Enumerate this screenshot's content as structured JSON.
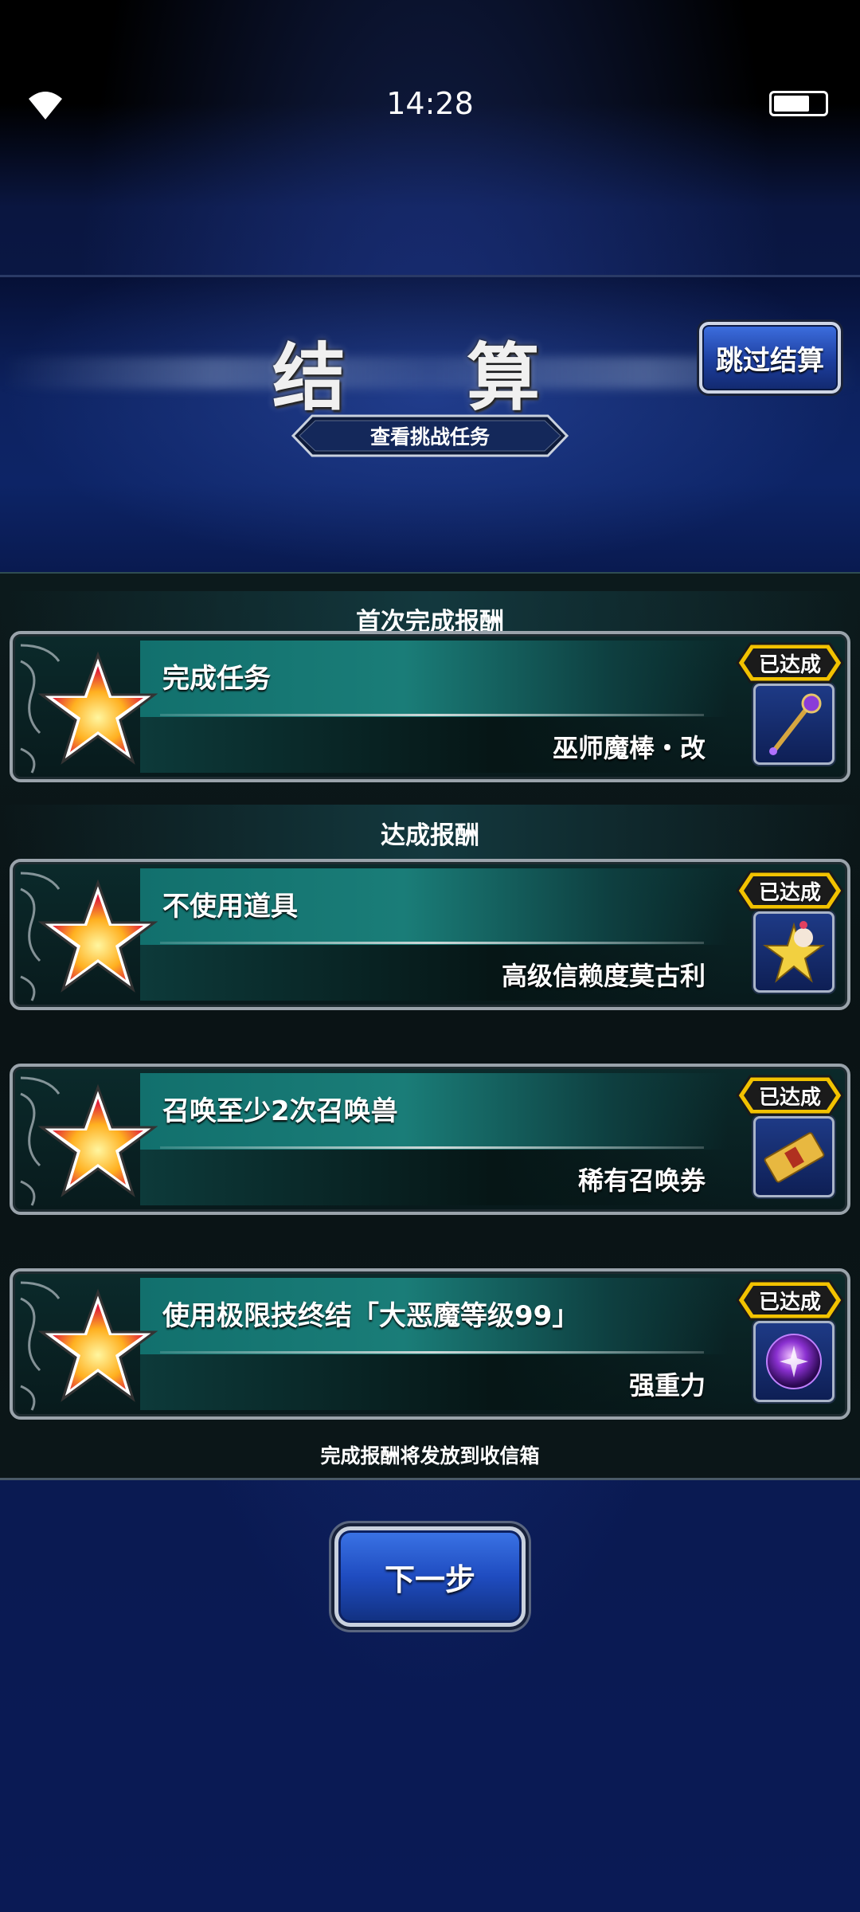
{
  "status_bar": {
    "time": "14:28",
    "battery_level": 0.65
  },
  "header": {
    "title": "结 算",
    "skip_label": "跳过结算",
    "view_tasks_label": "查看挑战任务"
  },
  "sections": {
    "first_clear": "首次完成报酬",
    "achievement": "达成报酬"
  },
  "rewards": [
    {
      "task": "完成任务",
      "reward": "巫师魔棒・改",
      "status": "已达成",
      "icon": "wizard-rod-icon"
    },
    {
      "task": "不使用道具",
      "reward": "高级信赖度莫古利",
      "status": "已达成",
      "icon": "moogle-star-icon"
    },
    {
      "task": "召唤至少2次召唤兽",
      "reward": "稀有召唤券",
      "status": "已达成",
      "icon": "summon-ticket-icon"
    },
    {
      "task": "使用极限技终结「大恶魔等级99」",
      "reward": "强重力",
      "status": "已达成",
      "icon": "gravity-orb-icon"
    }
  ],
  "footer_note": "完成报酬将发放到收信箱",
  "next_label": "下一步",
  "colors": {
    "accent_teal": "#12706d",
    "badge_gold": "#f2c200",
    "button_blue": "#1f4cc0"
  }
}
